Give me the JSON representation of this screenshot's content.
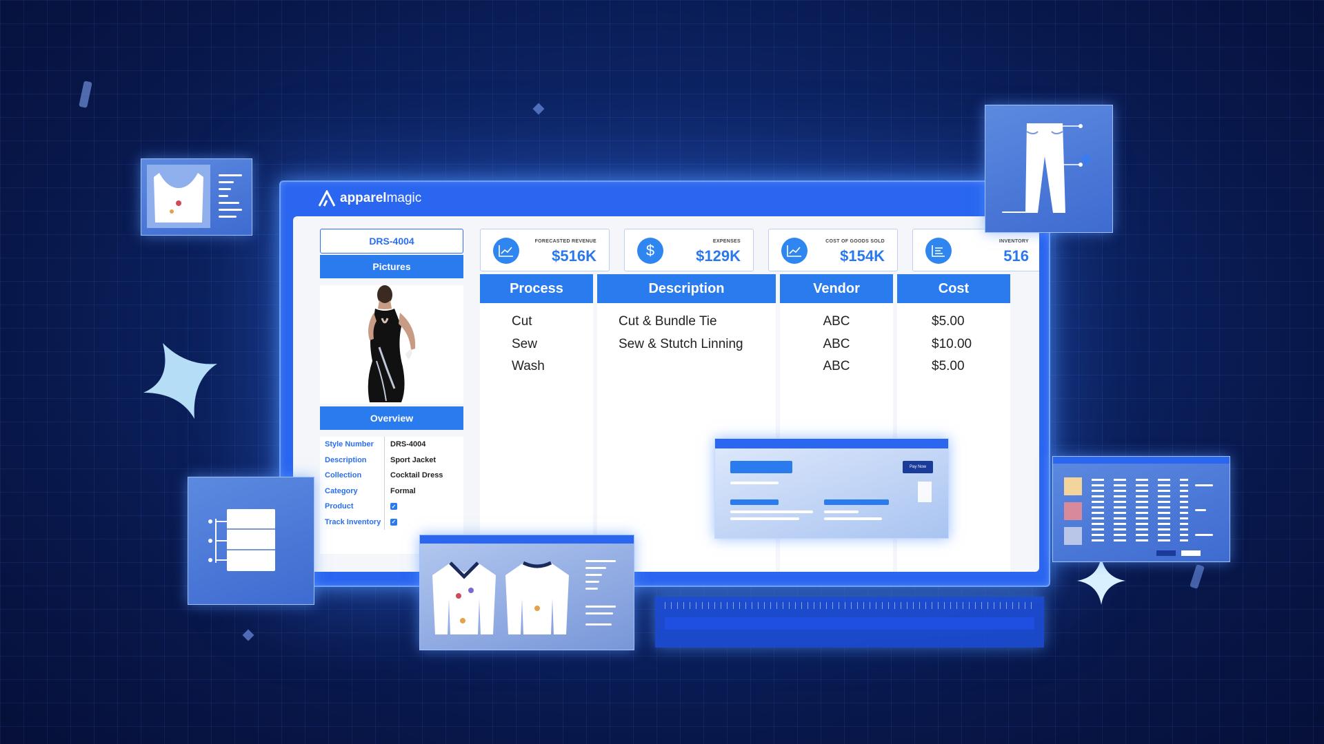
{
  "brand": {
    "bold": "apparel",
    "light": "magic"
  },
  "style_number_box": "DRS-4004",
  "sections": {
    "pictures": "Pictures",
    "overview": "Overview"
  },
  "overview": [
    {
      "key": "Style Number",
      "value": "DRS-4004"
    },
    {
      "key": "Description",
      "value": "Sport Jacket"
    },
    {
      "key": "Collection",
      "value": "Cocktail Dress"
    },
    {
      "key": "Category",
      "value": "Formal"
    },
    {
      "key": "Product",
      "checked": true
    },
    {
      "key": "Track Inventory",
      "checked": true
    }
  ],
  "stats": [
    {
      "label": "Forecasted Revenue",
      "value": "$516K",
      "icon": "chart-icon"
    },
    {
      "label": "Expenses",
      "value": "$129K",
      "icon": "dollar-icon"
    },
    {
      "label": "Cost of Goods Sold",
      "value": "$154K",
      "icon": "chart-icon"
    },
    {
      "label": "Inventory",
      "value": "516",
      "icon": "list-icon"
    }
  ],
  "table": {
    "headers": [
      "Process",
      "Description",
      "Vendor",
      "Cost"
    ],
    "rows": [
      [
        "Cut",
        "Cut & Bundle Tie",
        "ABC",
        "$5.00"
      ],
      [
        "Sew",
        "Sew & Stutch Linning",
        "ABC",
        "$10.00"
      ],
      [
        "Wash",
        "",
        "ABC",
        "$5.00"
      ]
    ]
  },
  "popup": {
    "button": "Pay Now"
  },
  "colors": {
    "accent": "#2a7bee",
    "background": "#0d2566",
    "window": "#2a66f0"
  }
}
